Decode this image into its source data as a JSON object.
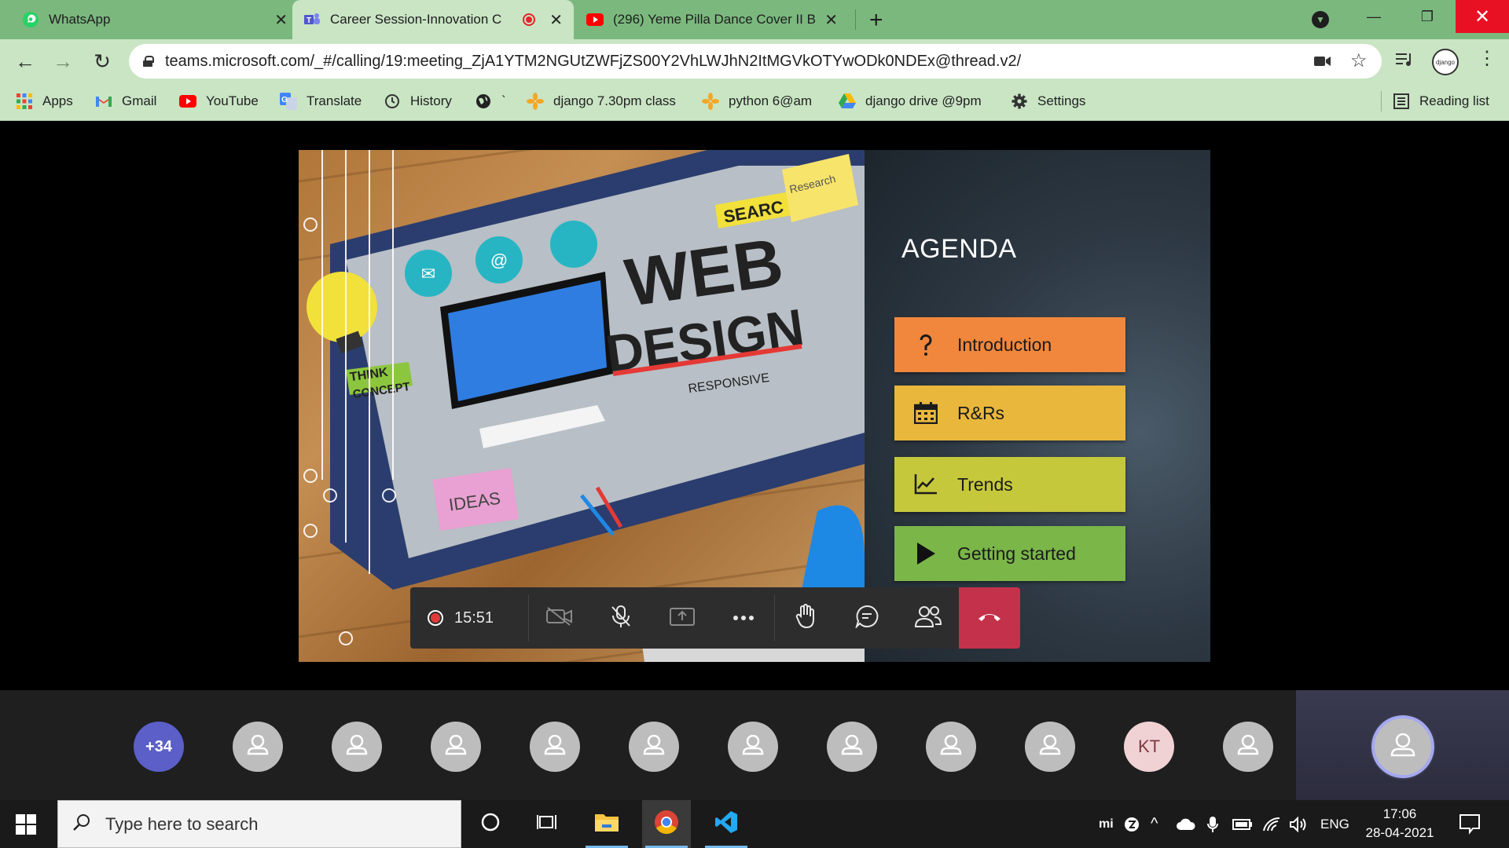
{
  "browser": {
    "tabs": [
      {
        "title": "WhatsApp",
        "icon": "whatsapp-icon",
        "active": false
      },
      {
        "title": "Career Session-Innovation C",
        "icon": "teams-icon",
        "active": true,
        "recording": true
      },
      {
        "title": "(296) Yeme Pilla Dance Cover II B",
        "icon": "youtube-icon",
        "active": false
      }
    ],
    "url": "teams.microsoft.com/_#/calling/19:meeting_ZjA1YTM2NGUtZWFjZS00Y2VhLWJhN2ItMGVkOTYwODk0NDEx@thread.v2/",
    "profile_label": "django",
    "bookmarks": [
      {
        "label": "Apps",
        "icon": "apps-grid-icon"
      },
      {
        "label": "Gmail",
        "icon": "gmail-icon"
      },
      {
        "label": "YouTube",
        "icon": "youtube-icon"
      },
      {
        "label": "Translate",
        "icon": "translate-icon"
      },
      {
        "label": "History",
        "icon": "history-icon"
      },
      {
        "label": "`",
        "icon": "globe-icon"
      },
      {
        "label": "django 7.30pm class",
        "icon": "bookmark-asterisk-icon"
      },
      {
        "label": "python 6@am",
        "icon": "bookmark-asterisk-icon"
      },
      {
        "label": "django drive @9pm",
        "icon": "google-drive-icon"
      },
      {
        "label": "Settings",
        "icon": "gear-icon"
      }
    ],
    "reading_list": "Reading list"
  },
  "slide": {
    "title": "AGENDA",
    "items": [
      {
        "label": "Introduction",
        "icon": "question-icon",
        "color": "#f0873c"
      },
      {
        "label": "R&Rs",
        "icon": "calendar-icon",
        "color": "#e9b73c"
      },
      {
        "label": "Trends",
        "icon": "line-chart-icon",
        "color": "#c6c83b"
      },
      {
        "label": "Getting started",
        "icon": "play-icon",
        "color": "#7ab648"
      }
    ],
    "photo_text": {
      "web": "WEB",
      "design": "DESIGN",
      "search": "SEARC",
      "responsive": "RESPONSIVE",
      "think": "THINK",
      "concept": "CONCEPT",
      "ideas": "IDEAS",
      "research": "Research"
    }
  },
  "call": {
    "timer": "15:51",
    "hangup_color": "#c4314b"
  },
  "participants": {
    "overflow_count": "+34",
    "initials": "KT"
  },
  "taskbar": {
    "search_placeholder": "Type here to search",
    "language": "ENG",
    "time": "17:06",
    "date": "28-04-2021",
    "tray_mi": "mi"
  }
}
